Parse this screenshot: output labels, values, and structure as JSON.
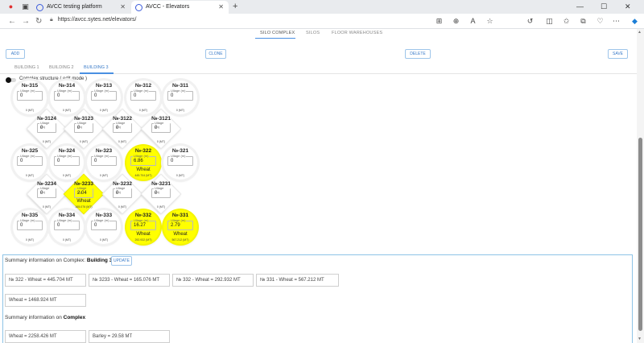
{
  "browser": {
    "tabs": [
      {
        "title": "AVCC testing platform",
        "active": false
      },
      {
        "title": "AVCC - Elevators",
        "active": true
      }
    ],
    "url": "https://avcc.sytes.net/elevators/"
  },
  "top_tabs": [
    "SILO COMPLEX",
    "SILOS",
    "FLOOR WAREHOUSES"
  ],
  "toolbar": {
    "add": "ADD",
    "clone": "CLONE",
    "delete": "DELETE",
    "save": "SAVE"
  },
  "building_tabs": [
    "BUILDING 1",
    "BUILDING 2",
    "BUILDING 3"
  ],
  "complex_label": "Complex structure ( edit mode )",
  "field_placeholder": "Ullage (m)",
  "silos": [
    {
      "num": "№-315",
      "value": "0",
      "mt": "0 (MT)",
      "grain": ""
    },
    {
      "num": "№-314",
      "value": "0",
      "mt": "0 (MT)",
      "grain": ""
    },
    {
      "num": "№-313",
      "value": "0",
      "mt": "0 (MT)",
      "grain": ""
    },
    {
      "num": "№-312",
      "value": "0",
      "mt": "0 (MT)",
      "grain": ""
    },
    {
      "num": "№-311",
      "value": "0",
      "mt": "0 (MT)",
      "grain": ""
    },
    {
      "num": "№-325",
      "value": "0",
      "mt": "0 (MT)",
      "grain": ""
    },
    {
      "num": "№-324",
      "value": "0",
      "mt": "0 (MT)",
      "grain": ""
    },
    {
      "num": "№-323",
      "value": "0",
      "mt": "0 (MT)",
      "grain": ""
    },
    {
      "num": "№-322",
      "value": "6.86",
      "mt": "445.704 (MT)",
      "grain": "Wheat"
    },
    {
      "num": "№-321",
      "value": "0",
      "mt": "0 (MT)",
      "grain": ""
    },
    {
      "num": "№-335",
      "value": "0",
      "mt": "0 (MT)",
      "grain": ""
    },
    {
      "num": "№-334",
      "value": "0",
      "mt": "0 (MT)",
      "grain": ""
    },
    {
      "num": "№-333",
      "value": "0",
      "mt": "0 (MT)",
      "grain": ""
    },
    {
      "num": "№-332",
      "value": "16.27",
      "mt": "292.932 (MT)",
      "grain": "Wheat"
    },
    {
      "num": "№-331",
      "value": "2.79",
      "mt": "567.212 (MT)",
      "grain": "Wheat"
    }
  ],
  "interstices": [
    {
      "num": "№-3124",
      "value": "0",
      "mt": "0 (MT)",
      "grain": ""
    },
    {
      "num": "№-3123",
      "value": "0",
      "mt": "0 (MT)",
      "grain": ""
    },
    {
      "num": "№-3122",
      "value": "0",
      "mt": "0 (MT)",
      "grain": ""
    },
    {
      "num": "№-3121",
      "value": "0",
      "mt": "0 (MT)",
      "grain": ""
    },
    {
      "num": "№-3234",
      "value": "0",
      "mt": "0 (MT)",
      "grain": ""
    },
    {
      "num": "№-3233",
      "value": "2.04",
      "mt": "165.076 (MT)",
      "grain": "Wheat"
    },
    {
      "num": "№-3232",
      "value": "0",
      "mt": "0 (MT)",
      "grain": ""
    },
    {
      "num": "№-3231",
      "value": "0",
      "mt": "0 (MT)",
      "grain": ""
    }
  ],
  "summary": {
    "building_prefix": "Summary information on Complex:",
    "building_name": "Building 3",
    "update": "UPDATE",
    "building_items": [
      "№ 322 - Wheat = 445.704 MT",
      "№ 3233 - Wheat = 165.076 MT",
      "№ 332 - Wheat = 292.932 MT",
      "№ 331 - Wheat = 567.212 MT"
    ],
    "building_total": "Wheat = 1468.924 MT",
    "complex_prefix": "Summary information on",
    "complex_name": "Complex",
    "complex_items": [
      "Wheat = 2258.426 MT",
      "Barley = 29.58 MT"
    ]
  },
  "colors": {
    "filled": "#ffff00",
    "accent": "#4a90e2"
  }
}
